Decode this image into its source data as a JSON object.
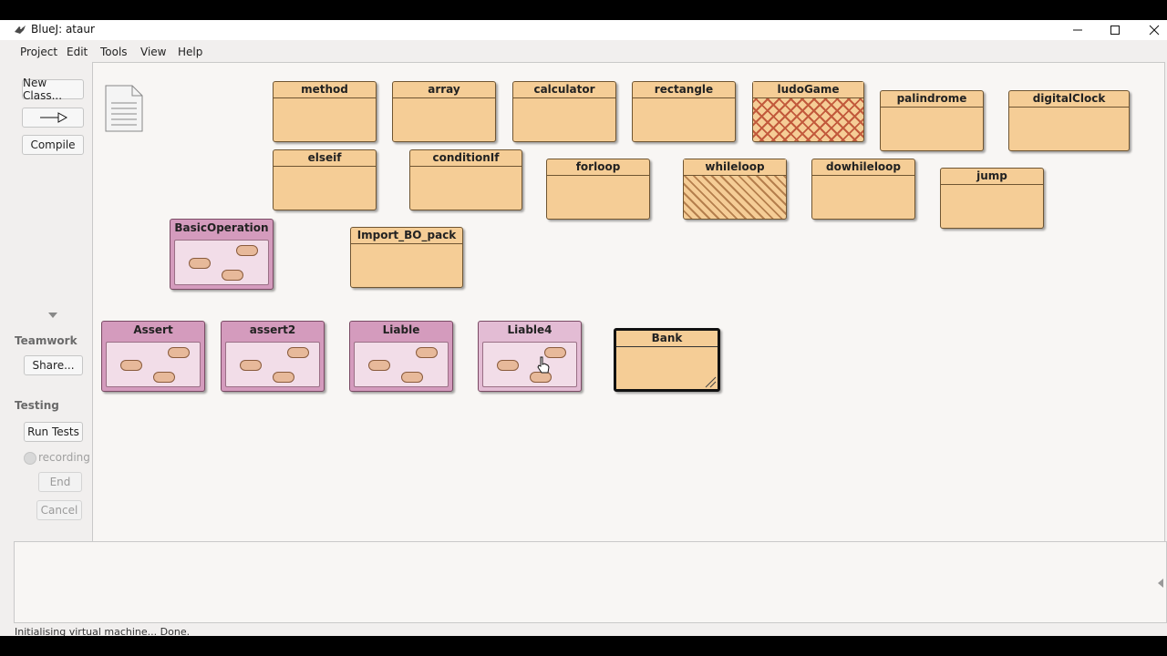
{
  "window": {
    "title": "BlueJ:  ataur"
  },
  "menu": [
    "Project",
    "Edit",
    "Tools",
    "View",
    "Help"
  ],
  "sidebar": {
    "new_class": "New Class...",
    "compile": "Compile",
    "teamwork_label": "Teamwork",
    "share": "Share...",
    "testing_label": "Testing",
    "run_tests": "Run Tests",
    "recording": "recording",
    "end": "End",
    "cancel": "Cancel"
  },
  "classes": {
    "method": "method",
    "array": "array",
    "calculator": "calculator",
    "rectangle": "rectangle",
    "ludoGame": "ludoGame",
    "palindrome": "palindrome",
    "digitalClock": "digitalClock",
    "elseif": "elseif",
    "conditionIf": "conditionIf",
    "forloop": "forloop",
    "whileloop": "whileloop",
    "dowhileloop": "dowhileloop",
    "jump": "jump",
    "import_bo_pack": "Import_BO_pack",
    "bank": "Bank"
  },
  "packages": {
    "basic_operation": "BasicOperation",
    "assert": "Assert",
    "assert2": "assert2",
    "liable": "Liable",
    "liable4": "Liable4"
  },
  "status_text": "Initialising virtual machine... Done.",
  "colors": {
    "class_fill": "#f5cd96",
    "package_fill": "#d49bbd",
    "canvas_bg": "#f8f6f4"
  }
}
